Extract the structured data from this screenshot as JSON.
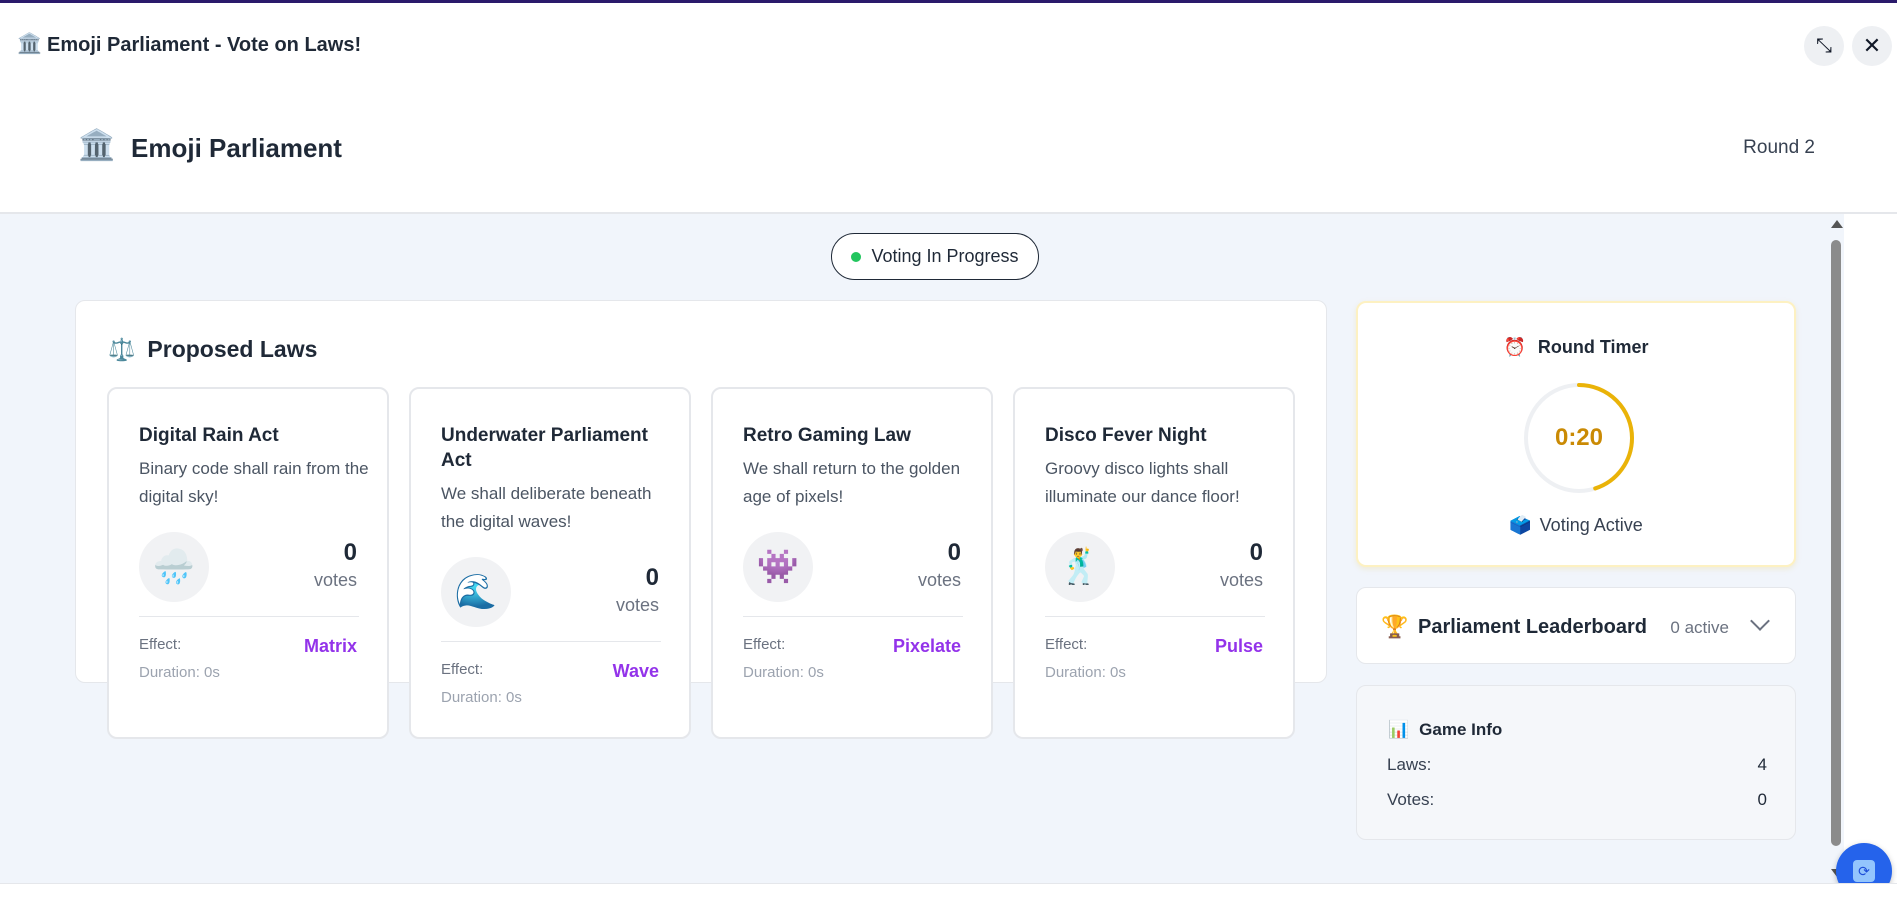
{
  "window": {
    "icon": "🏛️",
    "title": "Emoji Parliament - Vote on Laws!",
    "shrink_icon": "⤡",
    "close_icon": "✕"
  },
  "header": {
    "icon": "🏛️",
    "title": "Emoji Parliament",
    "round": "Round 2"
  },
  "status": {
    "label": "Voting In Progress",
    "dot_color": "#22c55e"
  },
  "laws_panel": {
    "icon": "⚖️",
    "title": "Proposed Laws",
    "laws": [
      {
        "title": "Digital Rain Act",
        "description": "Binary code shall rain from the digital sky!",
        "emoji": "🌧️",
        "votes": "0",
        "votes_label": "votes",
        "effect_label": "Effect:",
        "effect": "Matrix",
        "duration": "Duration: 0s"
      },
      {
        "title": "Underwater Parliament Act",
        "description": "We shall deliberate beneath the digital waves!",
        "emoji": "🌊",
        "votes": "0",
        "votes_label": "votes",
        "effect_label": "Effect:",
        "effect": "Wave",
        "duration": "Duration: 0s"
      },
      {
        "title": "Retro Gaming Law",
        "description": "We shall return to the golden age of pixels!",
        "emoji": "👾",
        "votes": "0",
        "votes_label": "votes",
        "effect_label": "Effect:",
        "effect": "Pixelate",
        "duration": "Duration: 0s"
      },
      {
        "title": "Disco Fever Night",
        "description": "Groovy disco lights shall illuminate our dance floor!",
        "emoji": "🕺",
        "votes": "0",
        "votes_label": "votes",
        "effect_label": "Effect:",
        "effect": "Pulse",
        "duration": "Duration: 0s"
      }
    ]
  },
  "timer": {
    "icon": "⏰",
    "title": "Round Timer",
    "value": "0:20",
    "remaining_fraction": 0.45,
    "status_icon": "🗳️",
    "status": "Voting Active",
    "accent": "#eab308"
  },
  "leaderboard": {
    "icon": "🏆",
    "title": "Parliament Leaderboard",
    "active": "0 active"
  },
  "game_info": {
    "icon": "📊",
    "title": "Game Info",
    "rows": [
      {
        "label": "Laws:",
        "value": "4"
      },
      {
        "label": "Votes:",
        "value": "0"
      }
    ]
  },
  "colors": {
    "effect": "#9333ea",
    "fab": "#2563eb"
  }
}
